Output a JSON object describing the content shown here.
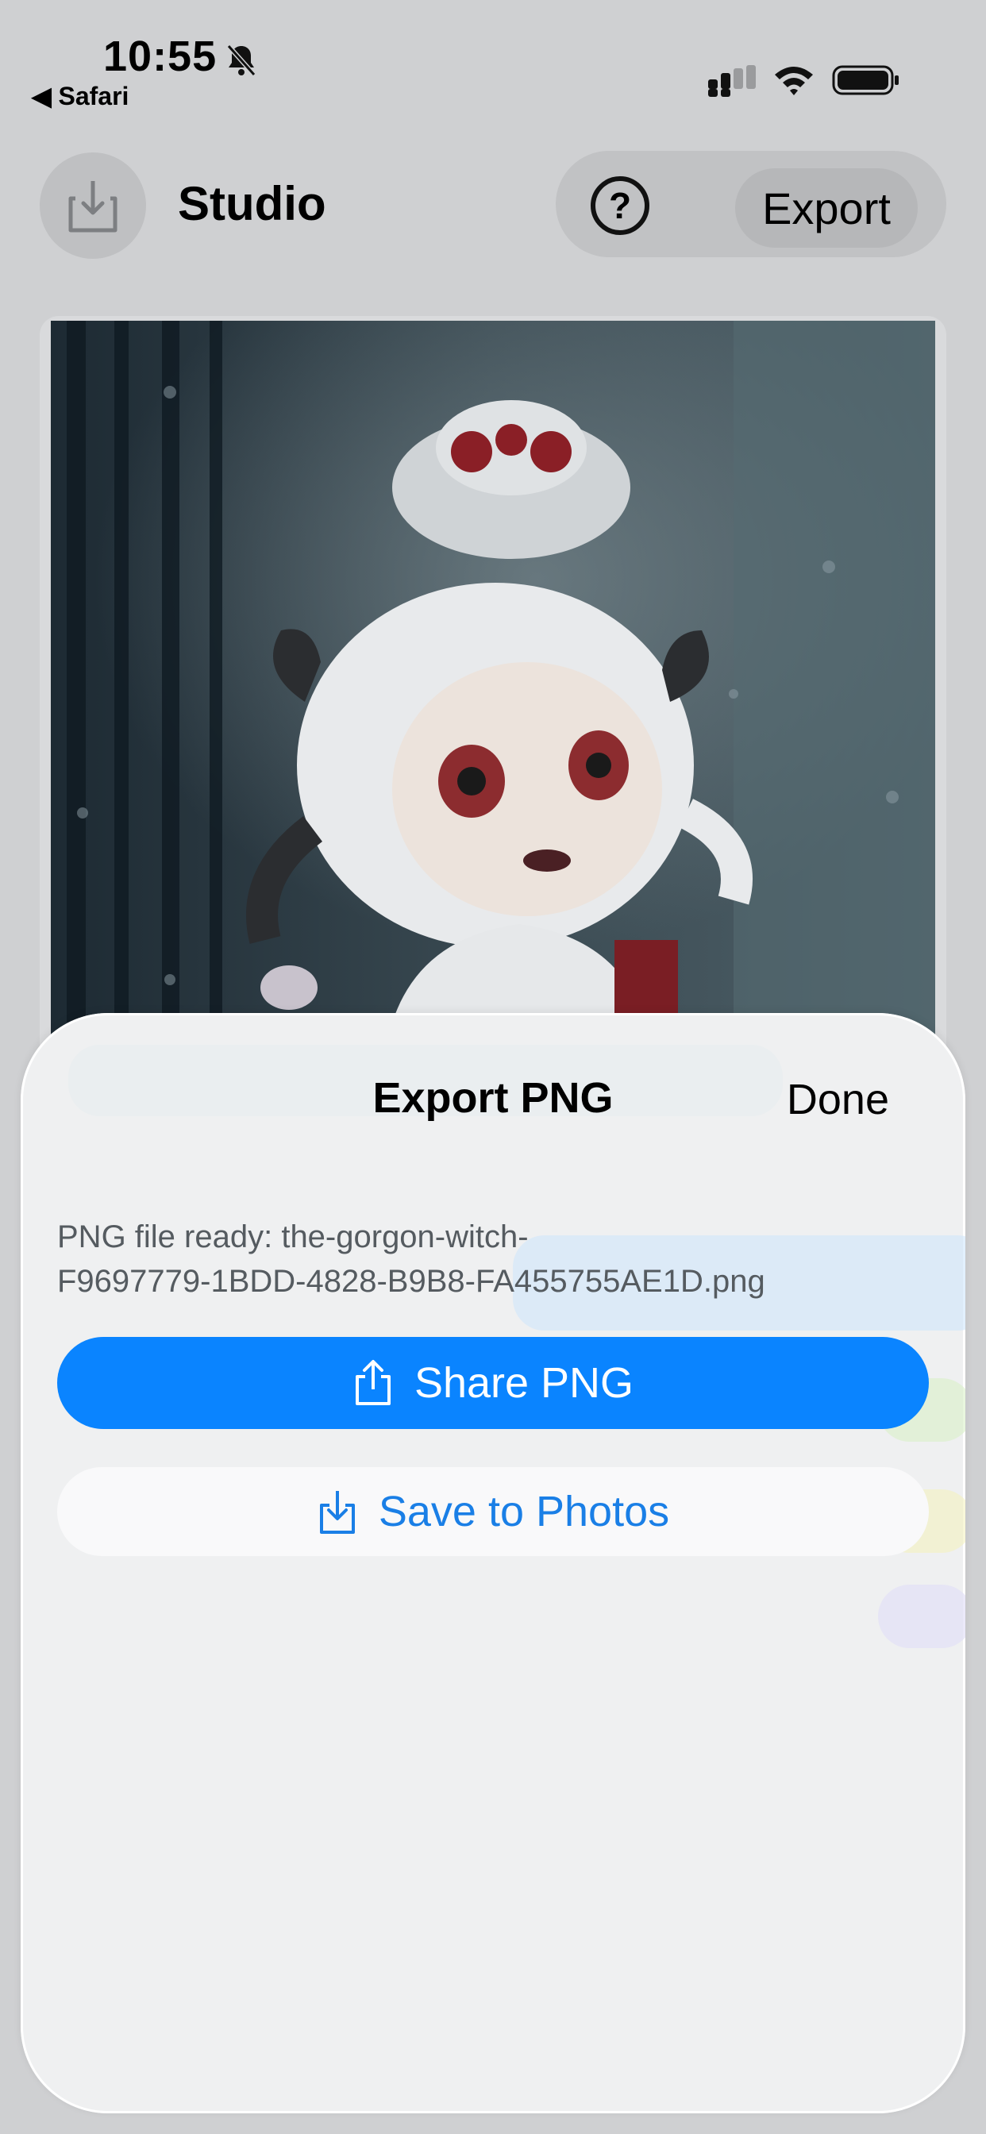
{
  "status_bar": {
    "time": "10:55",
    "back_app": "Safari",
    "icons": [
      "bell-slash-icon",
      "cellular-signal-icon",
      "wifi-icon",
      "battery-icon"
    ]
  },
  "header": {
    "title": "Studio",
    "help_label": "?",
    "export_label": "Export",
    "icons": [
      "import-tray-icon",
      "question-circle-icon"
    ]
  },
  "sheet": {
    "title": "Export PNG",
    "done_label": "Done",
    "file_line1": "PNG file ready: the-gorgon-witch-",
    "file_line2": "F9697779-1BDD-4828-B9B8-FA455755AE1D.png",
    "share_label": "Share PNG",
    "save_label": "Save to Photos",
    "icons": [
      "share-icon",
      "save-download-icon"
    ]
  },
  "colors": {
    "accent": "#0a84ff",
    "accent_text": "#1a7fe6",
    "sheet_bg": "#eff0f1",
    "page_bg": "#cfd0d2"
  }
}
